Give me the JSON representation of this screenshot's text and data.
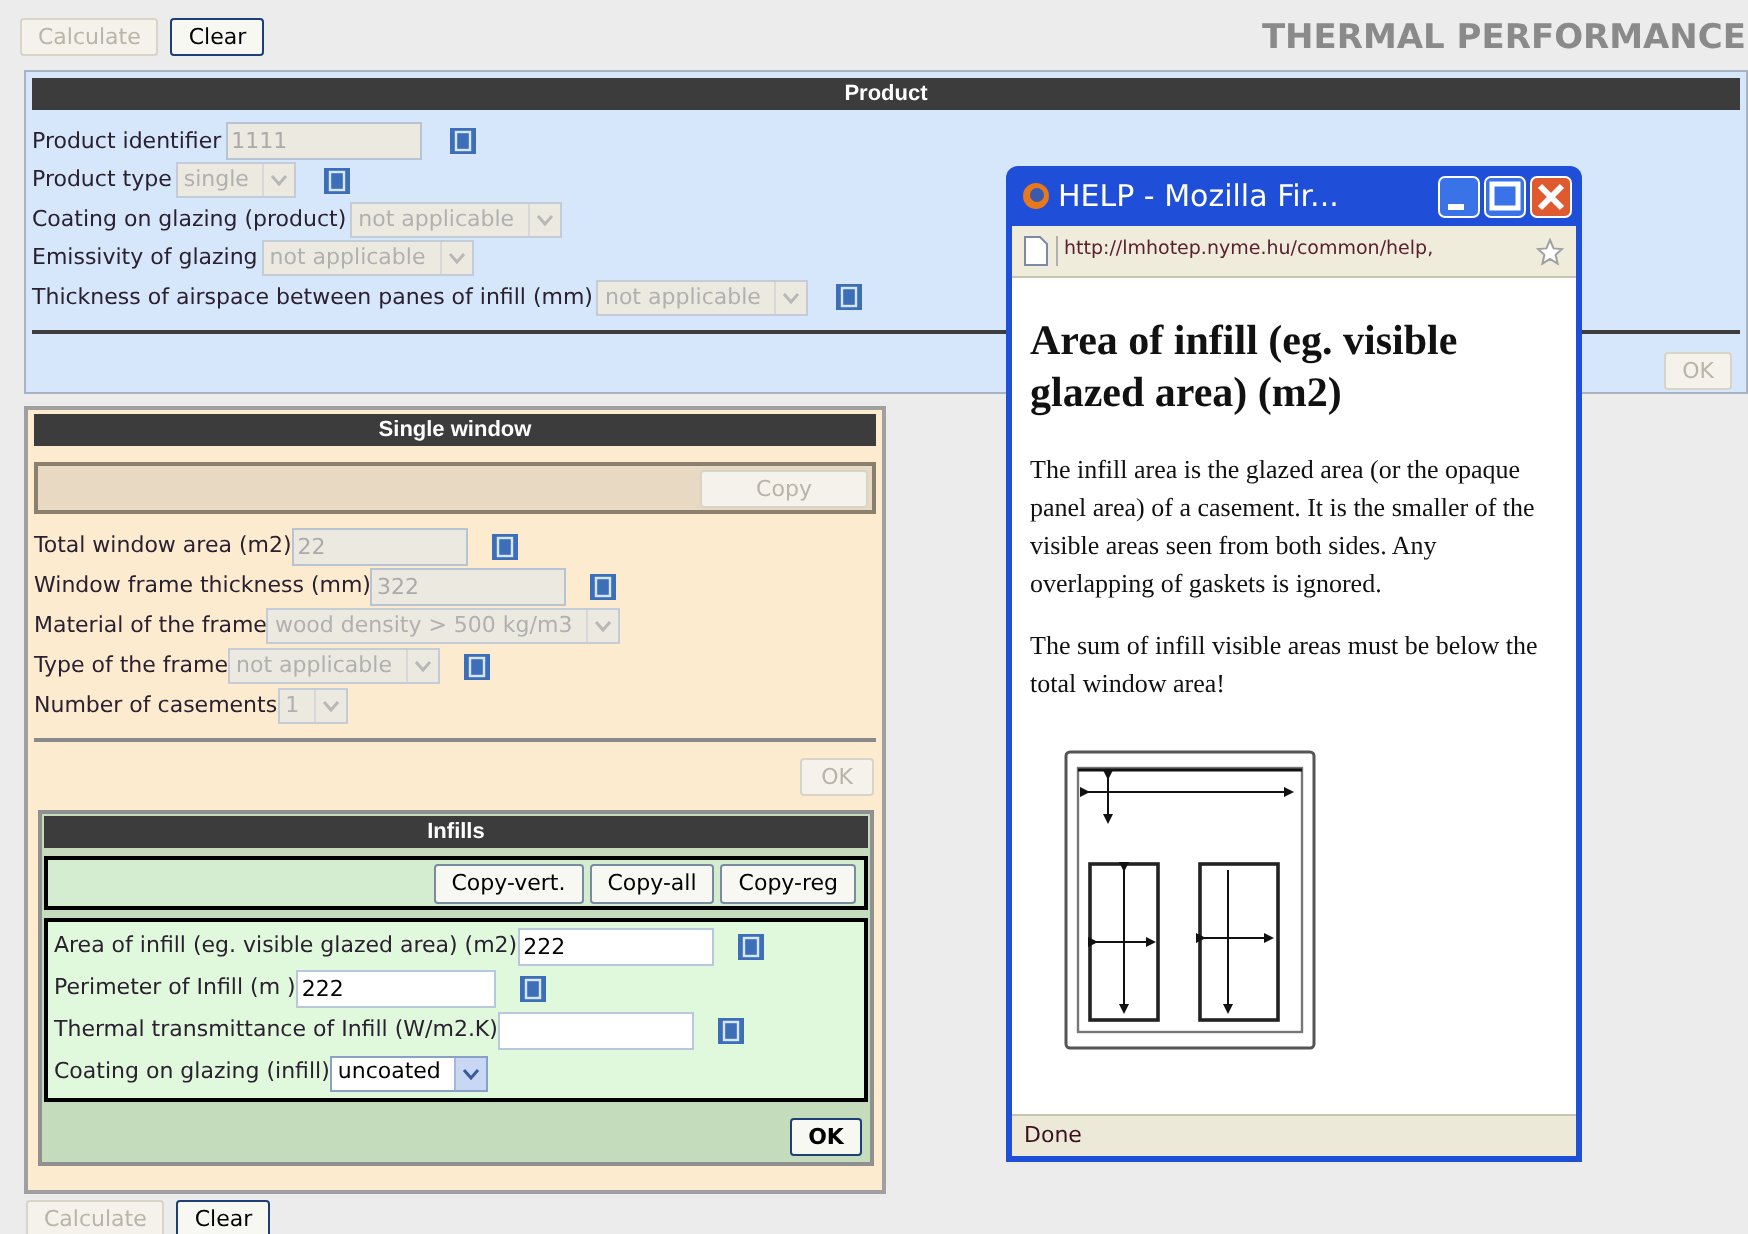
{
  "top_buttons": [
    {
      "label": "Calculate",
      "disabled": true
    },
    {
      "label": "Clear",
      "disabled": false
    }
  ],
  "page_title": "THERMAL PERFORMANCE",
  "product": {
    "title": "Product",
    "fields": [
      {
        "label": "Product identifier",
        "kind": "text",
        "value": "1111",
        "disabled": true,
        "help": true
      },
      {
        "label": "Product type",
        "kind": "select",
        "value": "single",
        "disabled": true,
        "help": true
      },
      {
        "label": "Coating on glazing (product)",
        "kind": "select",
        "value": "not applicable",
        "disabled": true,
        "help": false
      },
      {
        "label": "Emissivity of glazing",
        "kind": "select",
        "value": "not applicable",
        "disabled": true,
        "help": false
      },
      {
        "label": "Thickness of airspace between panes of infill (mm)",
        "kind": "select",
        "value": "not applicable",
        "disabled": true,
        "help": true
      }
    ],
    "ok": {
      "label": "OK",
      "disabled": true
    }
  },
  "single_window": {
    "title": "Single window",
    "copy_button": {
      "label": "Copy",
      "disabled": true
    },
    "fields": [
      {
        "label": "Total window area (m2)",
        "kind": "text",
        "value": "22",
        "disabled": true,
        "help": true
      },
      {
        "label": "Window frame thickness (mm)",
        "kind": "text",
        "value": "322",
        "disabled": true,
        "help": true
      },
      {
        "label": "Material of the frame",
        "kind": "select",
        "value": "wood density > 500 kg/m3",
        "disabled": true,
        "help": false
      },
      {
        "label": "Type of the frame",
        "kind": "select",
        "value": "not applicable",
        "disabled": true,
        "help": true
      },
      {
        "label": "Number of casements",
        "kind": "select",
        "value": "1",
        "disabled": true,
        "help": false
      }
    ],
    "ok": {
      "label": "OK",
      "disabled": true
    },
    "infills": {
      "title": "Infills",
      "buttons": [
        {
          "label": "Copy-vert.",
          "disabled": false
        },
        {
          "label": "Copy-all",
          "disabled": false
        },
        {
          "label": "Copy-reg",
          "disabled": false
        }
      ],
      "fields": [
        {
          "label": "Area of infill (eg. visible glazed area) (m2)",
          "kind": "text",
          "value": "222",
          "disabled": false,
          "help": true
        },
        {
          "label": "Perimeter of Infill (m )",
          "kind": "text",
          "value": "222",
          "disabled": false,
          "help": true
        },
        {
          "label": "Thermal transmittance of Infill (W/m2.K)",
          "kind": "text",
          "disabled": false,
          "help": true
        },
        {
          "label": "Coating on glazing (infill)",
          "kind": "select",
          "value": "uncoated",
          "disabled": false,
          "help": false
        }
      ],
      "ok": {
        "label": "OK",
        "disabled": false
      }
    }
  },
  "bottom_buttons": [
    {
      "label": "Calculate",
      "disabled": true
    },
    {
      "label": "Clear",
      "disabled": false
    }
  ],
  "help_window": {
    "title": "HELP - Mozilla Fir...",
    "url": "http://lmhotep.nyme.hu/common/help,",
    "heading": "Area of infill (eg. visible glazed area) (m2)",
    "paragraphs": [
      "The infill area is the glazed area (or the opaque panel area) of a casement. It is the smaller of the visible areas seen from both sides. Any overlapping of gaskets is ignored.",
      "The sum of infill visible areas must be below the total window area!"
    ],
    "status": "Done"
  }
}
